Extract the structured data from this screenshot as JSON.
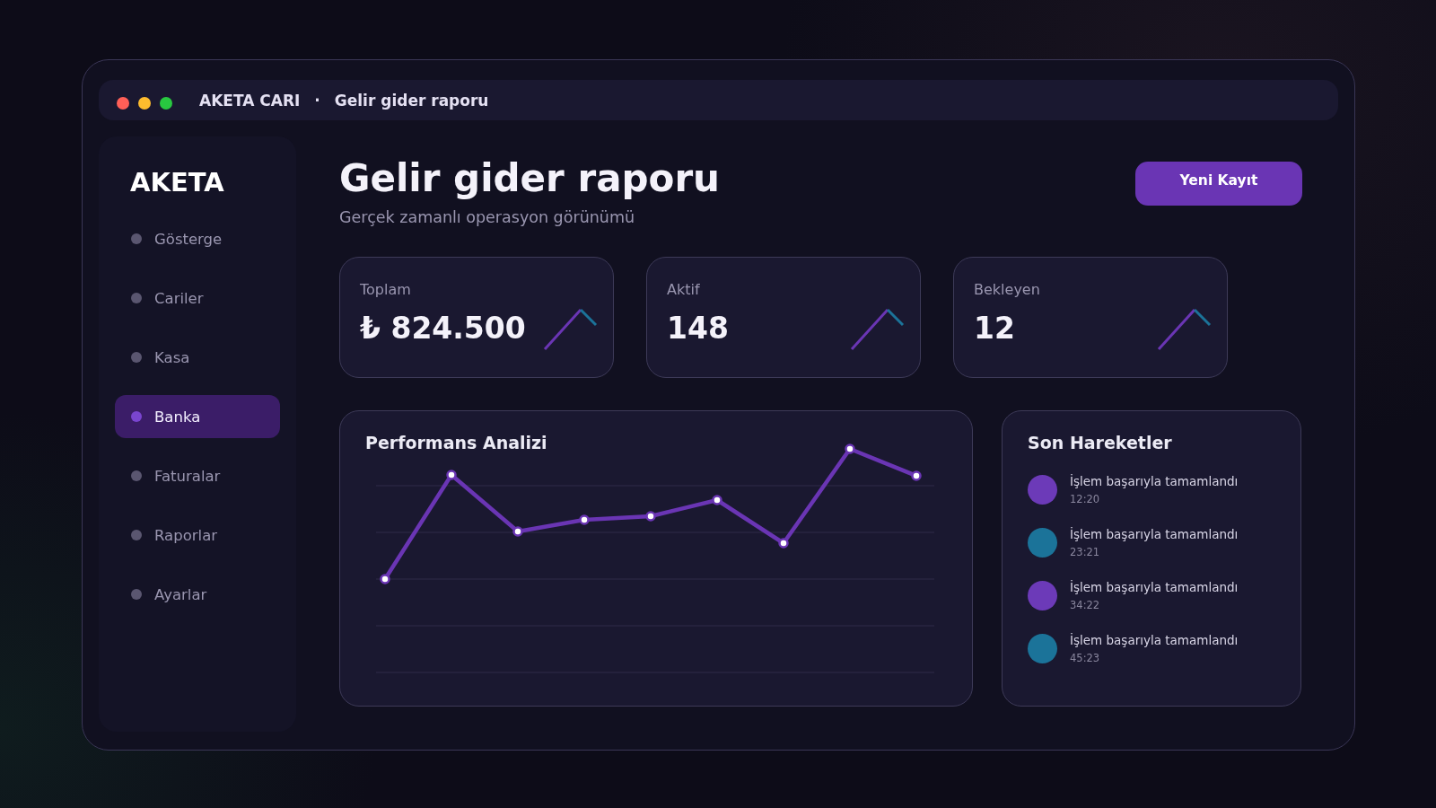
{
  "window": {
    "app": "AKETA CARI",
    "separator": "·",
    "title": "Gelir gider raporu"
  },
  "sidebar": {
    "brand": "AKETA",
    "items": [
      {
        "label": "Gösterge",
        "selected": false
      },
      {
        "label": "Cariler",
        "selected": false
      },
      {
        "label": "Kasa",
        "selected": false
      },
      {
        "label": "Banka",
        "selected": true
      },
      {
        "label": "Faturalar",
        "selected": false
      },
      {
        "label": "Raporlar",
        "selected": false
      },
      {
        "label": "Ayarlar",
        "selected": false
      }
    ]
  },
  "header": {
    "title": "Gelir gider raporu",
    "subtitle": "Gerçek zamanlı operasyon görünümü",
    "button": "Yeni Kayıt"
  },
  "stats": [
    {
      "label": "Toplam",
      "value": "₺ 824.500"
    },
    {
      "label": "Aktif",
      "value": "148"
    },
    {
      "label": "Bekleyen",
      "value": "12"
    }
  ],
  "performance": {
    "title": "Performans Analizi"
  },
  "activity": {
    "title": "Son Hareketler",
    "items": [
      {
        "text": "İşlem başarıyla tamamlandı",
        "time": "12:20",
        "color": "#6c3ab8"
      },
      {
        "text": "İşlem başarıyla tamamlandı",
        "time": "23:21",
        "color": "#1b7399"
      },
      {
        "text": "İşlem başarıyla tamamlandı",
        "time": "34:22",
        "color": "#6c3ab8"
      },
      {
        "text": "İşlem başarıyla tamamlandı",
        "time": "45:23",
        "color": "#1b7399"
      }
    ]
  }
}
